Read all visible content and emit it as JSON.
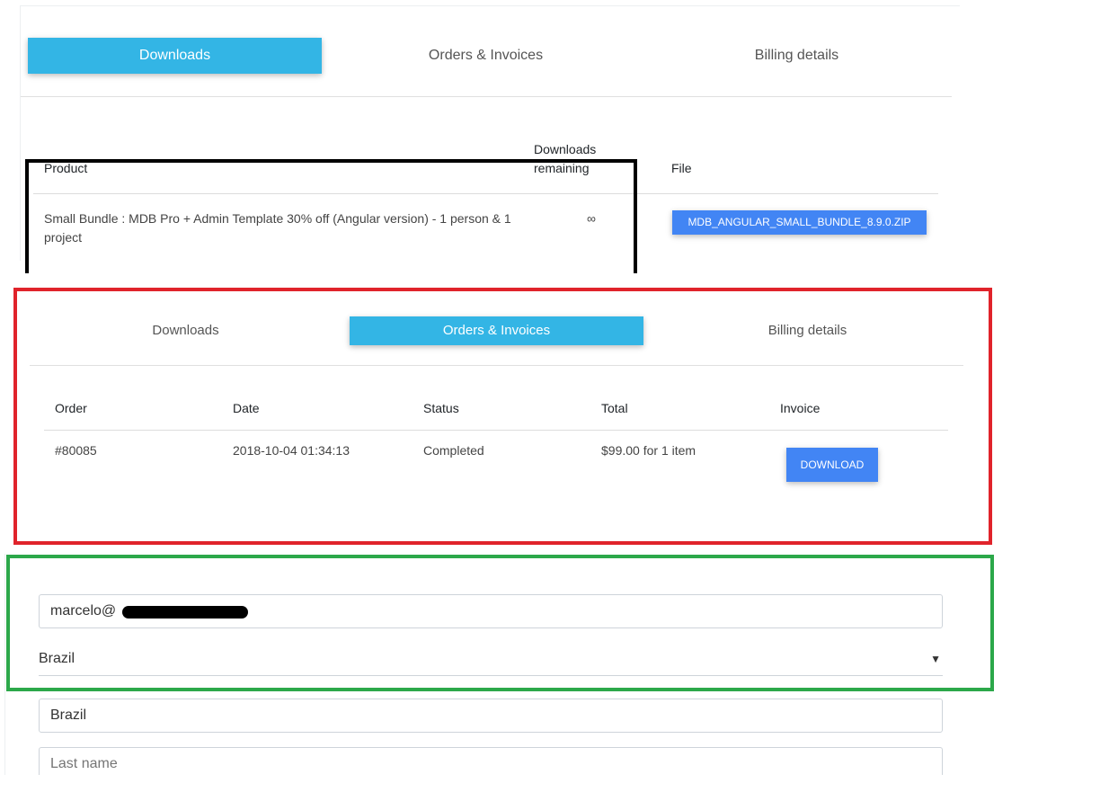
{
  "tabs": {
    "downloads": "Downloads",
    "orders": "Orders & Invoices",
    "billing": "Billing details"
  },
  "downloads_table": {
    "headers": {
      "product": "Product",
      "remaining_line1": "Downloads",
      "remaining_line2": "remaining",
      "file": "File"
    },
    "row": {
      "product_line1": "Small Bundle : MDB Pro + Admin Template 30% off (Angular version) - 1 person & 1",
      "product_line2": "project",
      "remaining": "∞",
      "file_button": "MDB_ANGULAR_SMALL_BUNDLE_8.9.0.ZIP"
    }
  },
  "orders_table": {
    "headers": {
      "order": "Order",
      "date": "Date",
      "status": "Status",
      "total": "Total",
      "invoice": "Invoice"
    },
    "row": {
      "order": "#80085",
      "date": "2018-10-04 01:34:13",
      "status": "Completed",
      "total": "$99.00 for 1 item",
      "invoice_button": "DOWNLOAD"
    }
  },
  "billing_form": {
    "email_value": "marcelo@",
    "country_select": "Brazil",
    "state_value": "Brazil",
    "last_name_placeholder": "Last name"
  },
  "colors": {
    "tab_active": "#33b5e5",
    "button_primary": "#4285f4",
    "frame_black": "#000000",
    "frame_red": "#e0232b",
    "frame_green": "#2ca84a"
  }
}
